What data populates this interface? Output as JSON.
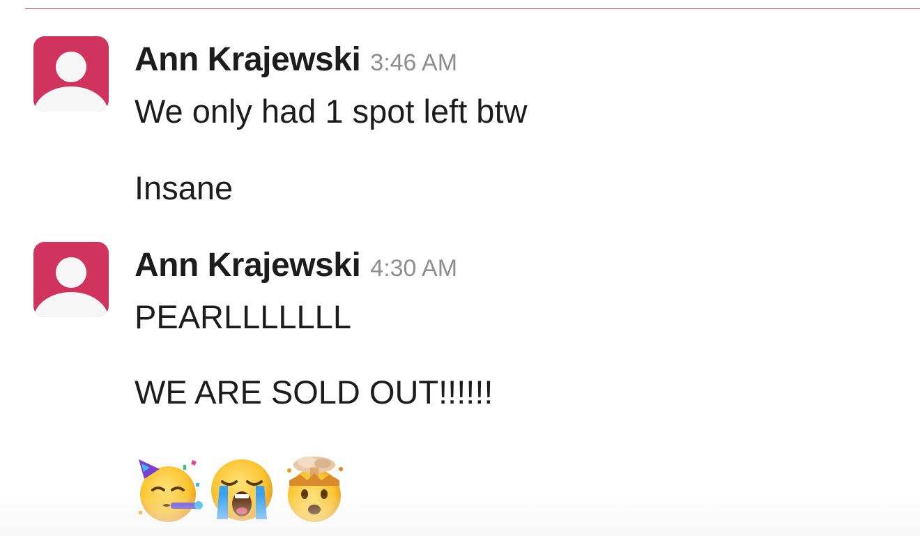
{
  "messages": [
    {
      "author": "Ann Krajewski",
      "time": "3:46 AM",
      "lines": [
        "We only had 1 spot left btw",
        "Insane"
      ]
    },
    {
      "author": "Ann Krajewski",
      "time": "4:30 AM",
      "lines": [
        "PEARLLLLLLL",
        "WE ARE SOLD OUT!!!!!!"
      ],
      "emojis": [
        "partying-face-emoji",
        "loudly-crying-face-emoji",
        "exploding-head-emoji"
      ]
    }
  ],
  "colors": {
    "avatar_bg": "#d0345e",
    "divider": "#d9536f",
    "timestamp": "#8f8d8f",
    "text": "#1d1c1d"
  }
}
